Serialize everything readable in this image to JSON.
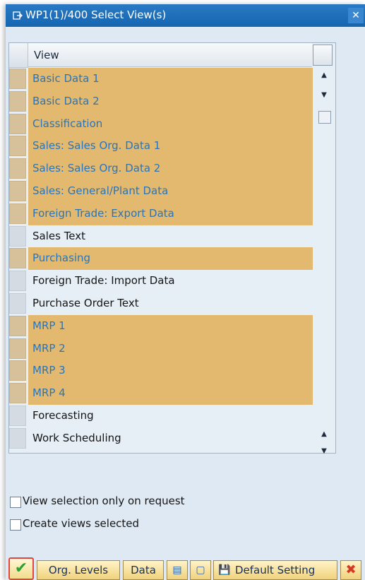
{
  "window": {
    "title": "WP1(1)/400 Select View(s)",
    "close_icon": "close-icon"
  },
  "table": {
    "column_header": "View",
    "rows": [
      {
        "label": "Basic Data 1",
        "selected": true
      },
      {
        "label": "Basic Data 2",
        "selected": true
      },
      {
        "label": "Classification",
        "selected": true
      },
      {
        "label": "Sales: Sales Org. Data 1",
        "selected": true
      },
      {
        "label": "Sales: Sales Org. Data 2",
        "selected": true
      },
      {
        "label": "Sales: General/Plant Data",
        "selected": true
      },
      {
        "label": "Foreign Trade: Export Data",
        "selected": true
      },
      {
        "label": "Sales Text",
        "selected": false
      },
      {
        "label": "Purchasing",
        "selected": true
      },
      {
        "label": "Foreign Trade: Import Data",
        "selected": false
      },
      {
        "label": "Purchase Order Text",
        "selected": false
      },
      {
        "label": "MRP 1",
        "selected": true
      },
      {
        "label": "MRP 2",
        "selected": true
      },
      {
        "label": "MRP 3",
        "selected": true
      },
      {
        "label": "MRP 4",
        "selected": true
      },
      {
        "label": "Forecasting",
        "selected": false
      },
      {
        "label": "Work Scheduling",
        "selected": false
      }
    ],
    "selected_color": "#e3b970",
    "selected_text_color": "#2b74b6"
  },
  "options": {
    "view_selection_only_on_request": "View selection only on request",
    "create_views_selected": "Create views selected"
  },
  "toolbar": {
    "org_levels": "Org. Levels",
    "data": "Data",
    "default_setting": "Default Setting"
  }
}
